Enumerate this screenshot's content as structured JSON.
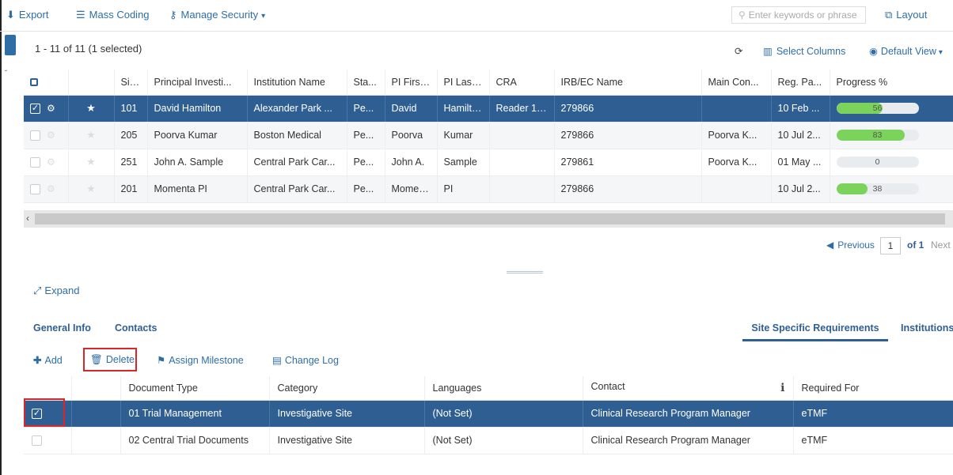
{
  "toolbar": {
    "export_label": "Export",
    "mass_coding_label": "Mass Coding",
    "manage_security_label": "Manage Security",
    "search_placeholder": "Enter keywords or phrase",
    "layout_label": "Layout"
  },
  "grid": {
    "count_text": "1 - 11 of 11 (1 selected)",
    "select_columns_label": "Select Columns",
    "default_view_label": "Default View",
    "columns": [
      "Site...",
      "Principal Investi...",
      "Institution Name",
      "Sta...",
      "PI First ...",
      "PI Last ...",
      "CRA",
      "IRB/EC Name",
      "Main Con...",
      "Reg. Pa...",
      "Progress %"
    ],
    "rows": [
      {
        "site": "101",
        "pi": "David Hamilton",
        "institution": "Alexander Park ...",
        "status": "Pe...",
        "first": "David",
        "last": "Hamilton",
        "cra": "Reader 10...",
        "irb": "279866",
        "main_contact": "",
        "reg": "10 Feb ...",
        "progress": 56,
        "progress_text": "56",
        "selected": true
      },
      {
        "site": "205",
        "pi": "Poorva Kumar",
        "institution": "Boston Medical",
        "status": "Pe...",
        "first": "Poorva",
        "last": "Kumar",
        "cra": "",
        "irb": "279866",
        "main_contact": "Poorva K...",
        "reg": "10 Jul 2...",
        "progress": 83,
        "progress_text": "83",
        "selected": false
      },
      {
        "site": "251",
        "pi": "John A. Sample",
        "institution": "Central Park Car...",
        "status": "Pe...",
        "first": "John A.",
        "last": "Sample",
        "cra": "",
        "irb": "279861",
        "main_contact": "Poorva K...",
        "reg": "01 May ...",
        "progress": 0,
        "progress_text": "0",
        "selected": false
      },
      {
        "site": "201",
        "pi": "Momenta PI",
        "institution": "Central Park Car...",
        "status": "Pe...",
        "first": "Momen...",
        "last": "PI",
        "cra": "",
        "irb": "279866",
        "main_contact": "",
        "reg": "10 Jul 2...",
        "progress": 38,
        "progress_text": "38",
        "selected": false
      }
    ]
  },
  "pager": {
    "previous_label": "Previous",
    "page": "1",
    "of_label": "of 1",
    "next_label": "Next"
  },
  "detail": {
    "expand_label": "Expand",
    "tabs": [
      "General Info",
      "Contacts",
      "Site Specific Requirements",
      "Institutions"
    ],
    "actions": {
      "add": "Add",
      "delete": "Delete",
      "assign_milestone": "Assign Milestone",
      "change_log": "Change Log"
    },
    "columns": [
      "Document Type",
      "Category",
      "Languages",
      "Contact",
      "Required For"
    ],
    "rows": [
      {
        "document_type": "01 Trial Management",
        "category": "Investigative Site",
        "languages": "(Not Set)",
        "contact": "Clinical Research Program Manager",
        "required_for": "eTMF",
        "selected": true
      },
      {
        "document_type": "02 Central Trial Documents",
        "category": "Investigative Site",
        "languages": "(Not Set)",
        "contact": "Clinical Research Program Manager",
        "required_for": "eTMF",
        "selected": false
      }
    ]
  },
  "colors": {
    "primary": "#2f6ea5",
    "selected_row": "#2f5f92",
    "progress_fill": "#7bd35b",
    "highlight_box": "#d9262b"
  },
  "icons": [
    "download-arrow-icon",
    "database-icon",
    "key-icon",
    "caret-down-icon",
    "search-icon",
    "layout-icon",
    "refresh-icon",
    "columns-icon",
    "eye-icon",
    "gear-icon",
    "star-icon",
    "info-icon",
    "expand-arrow-icon",
    "plus-circle-icon",
    "trash-icon",
    "flag-icon",
    "log-icon"
  ]
}
